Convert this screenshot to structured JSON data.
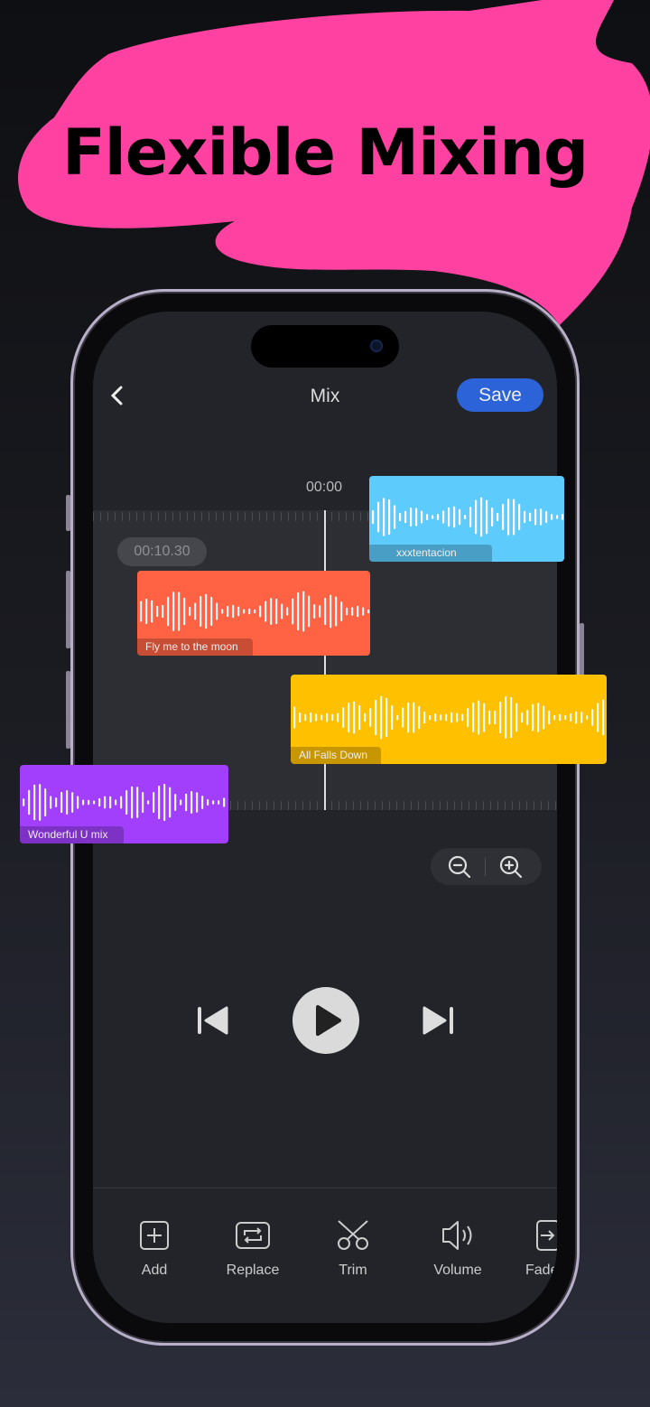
{
  "headline": "Flexible Mixing",
  "header": {
    "title": "Mix",
    "save_label": "Save",
    "back_icon": "chevron-left-icon"
  },
  "timeline": {
    "current_time": "00:00",
    "position_badge": "00:10.30"
  },
  "tracks": [
    {
      "name": "xxxtentacion",
      "color": "#5ecbfd"
    },
    {
      "name": "Fly me to the moon",
      "color": "#ff6344"
    },
    {
      "name": "All Falls Down",
      "color": "#ffc000"
    },
    {
      "name": "Wonderful U mix",
      "color": "#a23ffd"
    }
  ],
  "zoom_controls": {
    "zoom_out_icon": "zoom-out-icon",
    "zoom_in_icon": "zoom-in-icon"
  },
  "playback": {
    "prev_icon": "skip-previous-icon",
    "play_icon": "play-icon",
    "next_icon": "skip-next-icon"
  },
  "toolbar": [
    {
      "label": "Add",
      "icon": "add-square-icon"
    },
    {
      "label": "Replace",
      "icon": "replace-icon"
    },
    {
      "label": "Trim",
      "icon": "scissors-icon"
    },
    {
      "label": "Volume",
      "icon": "volume-icon"
    },
    {
      "label": "Fade",
      "icon": "fade-icon"
    }
  ],
  "colors": {
    "accent": "#2c63d9",
    "headline_bg": "#ff42a1"
  }
}
